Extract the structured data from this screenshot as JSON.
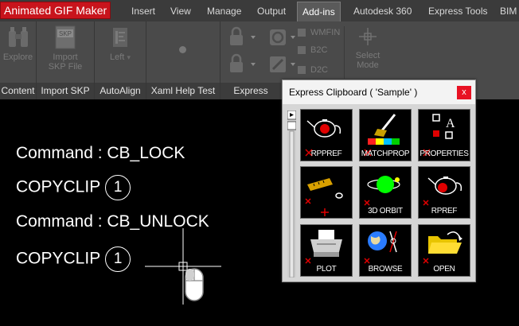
{
  "gif_label": "Animated GIF Maker",
  "tabs": [
    {
      "label": "Insert"
    },
    {
      "label": "View"
    },
    {
      "label": "Manage"
    },
    {
      "label": "Output"
    },
    {
      "label": "Add-ins",
      "active": true
    },
    {
      "label": "Autodesk 360"
    },
    {
      "label": "Express Tools"
    },
    {
      "label": "BIM"
    }
  ],
  "ribbon": {
    "panels": [
      {
        "title": "Content",
        "button": "Explore"
      },
      {
        "title": "Import SKP",
        "button_line1": "Import",
        "button_line2": "SKP File",
        "icon_text": "SKP"
      },
      {
        "title": "AutoAlign",
        "button": "Left"
      },
      {
        "title": "Xaml Help Test"
      },
      {
        "title": "Express"
      }
    ],
    "small_items": [
      "WMFIN",
      "B2C",
      "D2C"
    ],
    "select_mode_line1": "Select",
    "select_mode_line2": "Mode"
  },
  "commands": [
    {
      "text": "Command : CB_LOCK"
    },
    {
      "text": "COPYCLIP",
      "badge": "1"
    },
    {
      "text": "Command : CB_UNLOCK"
    },
    {
      "text": "COPYCLIP",
      "badge": "1"
    }
  ],
  "clipboard": {
    "title": "Express Clipboard ( 'Sample' )",
    "close_label": "x",
    "tiles": [
      {
        "label": "RPPREF",
        "icon": "teapot-icon"
      },
      {
        "label": "MATCHPROP",
        "icon": "paintbrush-icon"
      },
      {
        "label": "PROPERTIES",
        "icon": "properties-icon"
      },
      {
        "label": "",
        "icon": "ruler-icon"
      },
      {
        "label": "3D ORBIT",
        "icon": "orbit-icon"
      },
      {
        "label": "RPREF",
        "icon": "teapot-icon"
      },
      {
        "label": "PLOT",
        "icon": "printer-icon"
      },
      {
        "label": "BROWSE",
        "icon": "globe-icon"
      },
      {
        "label": "OPEN",
        "icon": "folder-icon"
      }
    ]
  },
  "colors": {
    "tabbar": "#3b3b3b",
    "ribbon": "#4a4a4a",
    "gif_label_bg": "#c8141c",
    "close_button": "#e81123",
    "canvas": "#000000"
  }
}
